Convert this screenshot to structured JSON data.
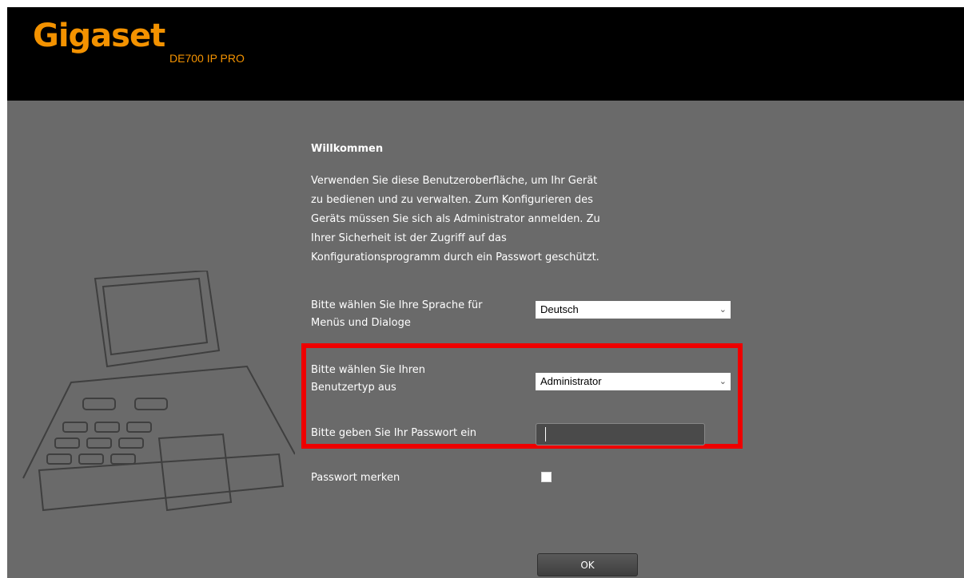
{
  "header": {
    "logo_text": "Gigaset",
    "model": "DE700 IP PRO"
  },
  "welcome": {
    "title": "Willkommen",
    "intro_lines": [
      "Verwenden Sie diese Benutzeroberfläche, um Ihr Gerät",
      "zu bedienen und zu verwalten. Zum Konfigurieren des",
      "Geräts müssen Sie sich als Administrator anmelden. Zu",
      "Ihrer Sicherheit ist der Zugriff auf das",
      "Konfigurationsprogramm durch ein Passwort geschützt."
    ]
  },
  "form": {
    "language_label_line1": "Bitte wählen Sie Ihre Sprache für",
    "language_label_line2": "Menüs und Dialoge",
    "language_value": "Deutsch",
    "usertype_label_line1": "Bitte wählen Sie Ihren",
    "usertype_label_line2": "Benutzertyp aus",
    "usertype_value": "Administrator",
    "password_label": "Bitte geben Sie Ihr Passwort ein",
    "password_value": "",
    "remember_label": "Passwort merken",
    "remember_checked": false,
    "ok_label": "OK"
  },
  "colors": {
    "brand_orange": "#f39200",
    "highlight_red": "#ee0000",
    "panel_gray": "#6a6a6a"
  }
}
